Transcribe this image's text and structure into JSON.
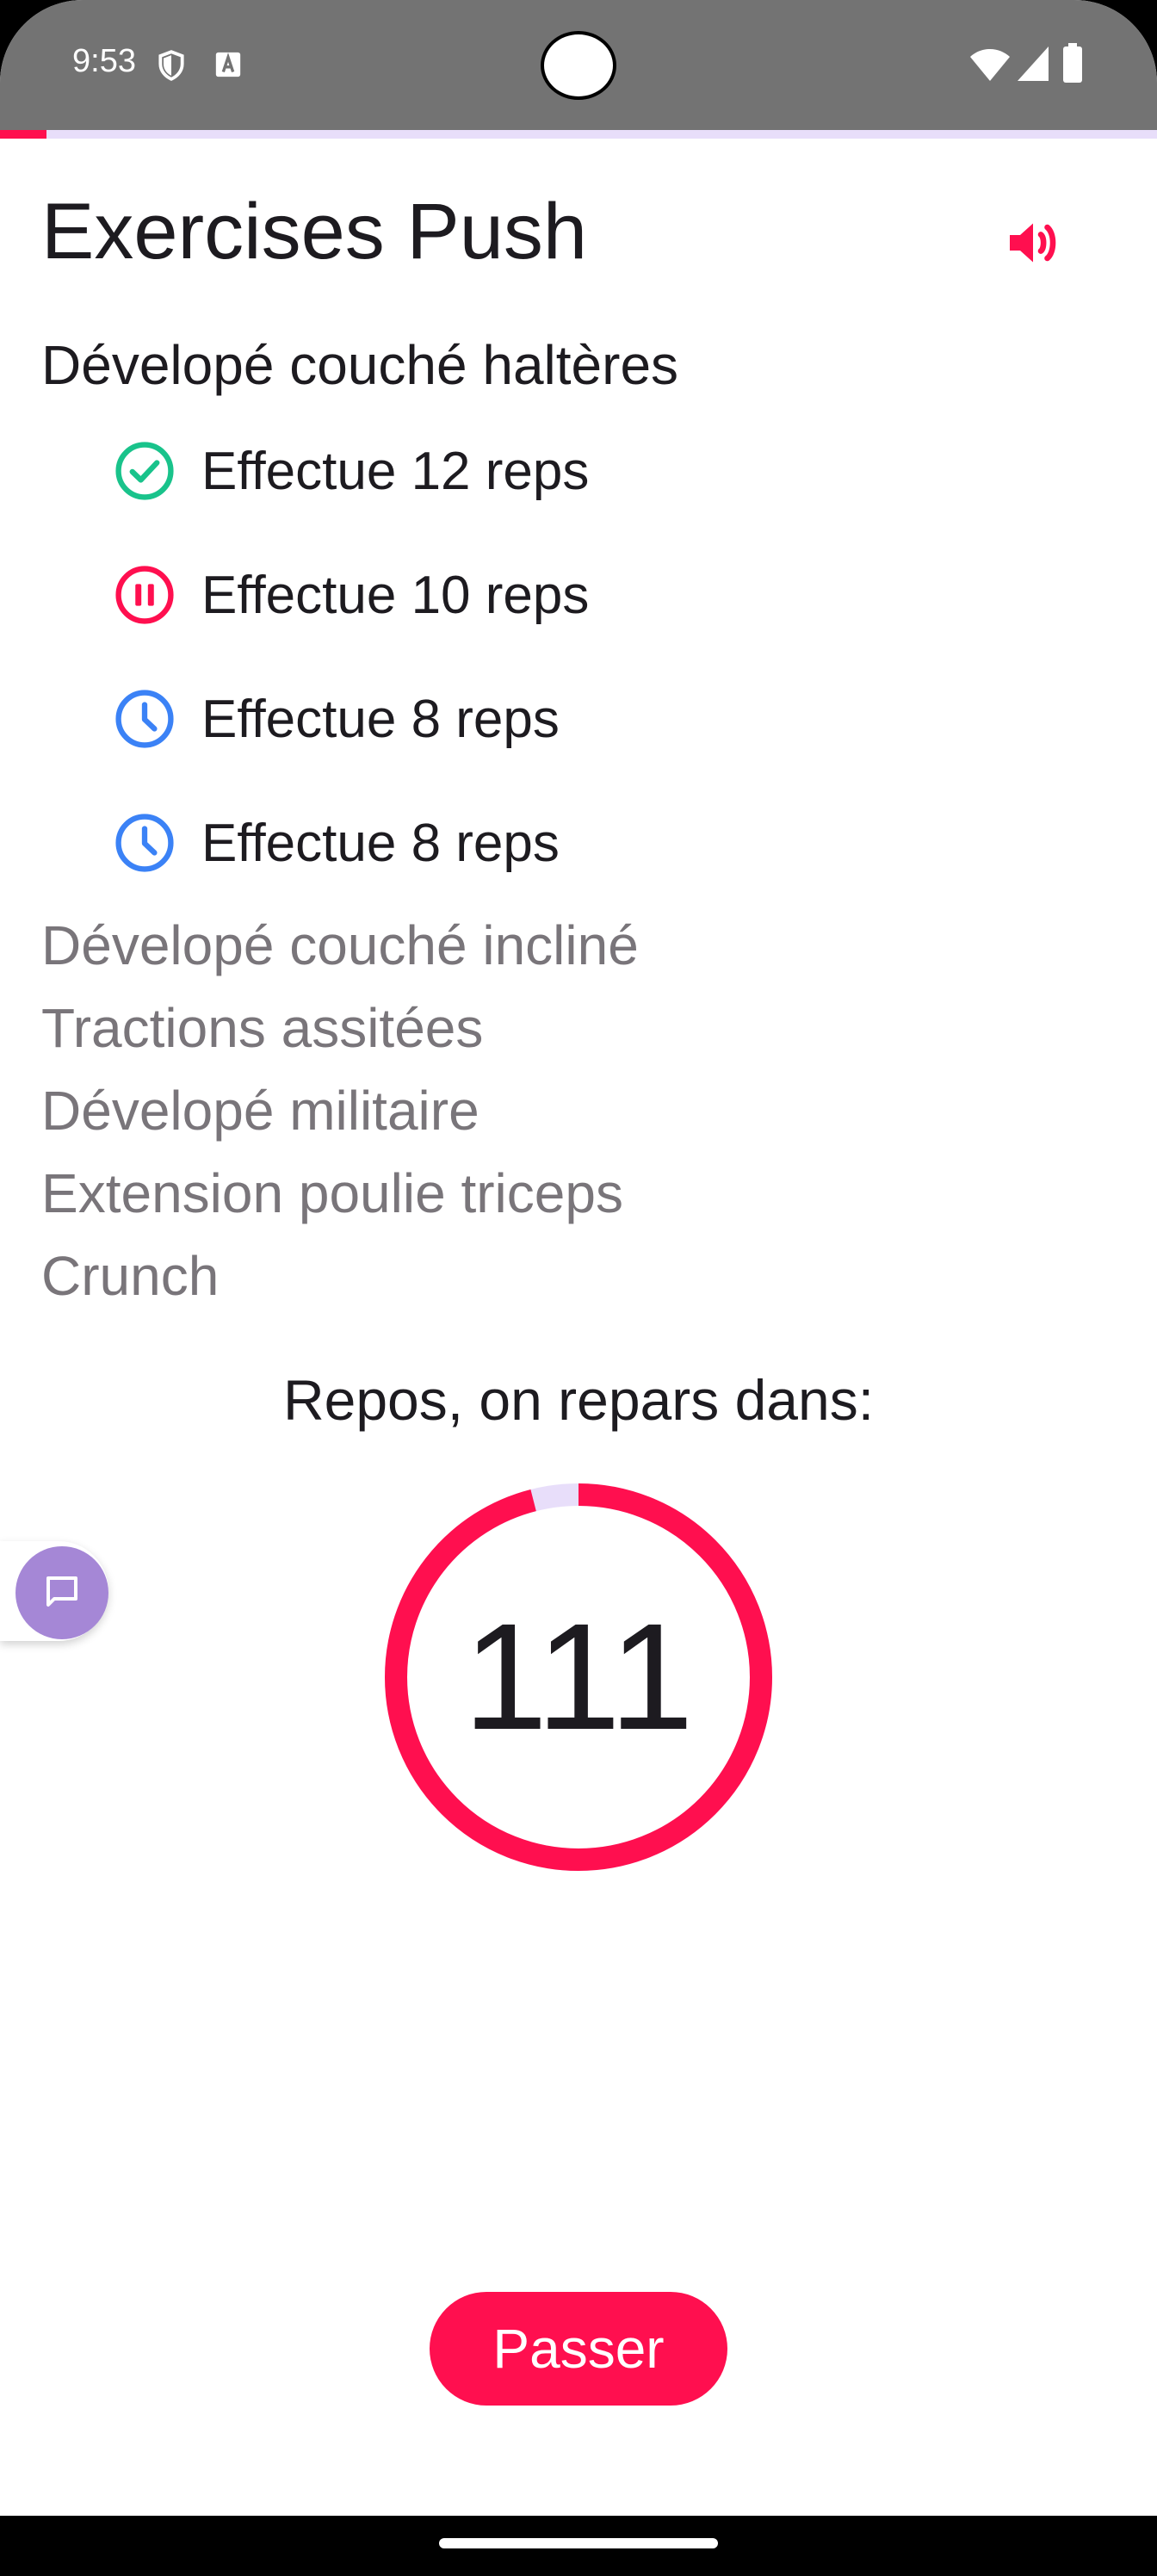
{
  "status_bar": {
    "time": "9:53",
    "icons_left": [
      "shield-icon",
      "keyboard-a-icon"
    ],
    "icons_right": [
      "wifi-icon",
      "signal-icon",
      "battery-icon"
    ],
    "background": "#737373"
  },
  "progress": {
    "fraction": 0.04,
    "fill_color": "#ff0f4f",
    "track_color": "#e8defa"
  },
  "header": {
    "title": "Exercises Push",
    "sound_icon": "volume-up-icon",
    "accent": "#ff0f4f"
  },
  "current_exercise": {
    "name": "Dévelopé couché haltères",
    "sets": [
      {
        "label": "Effectue 12 reps",
        "status": "done",
        "icon": "check-circle-icon",
        "color": "#19c38b"
      },
      {
        "label": "Effectue 10 reps",
        "status": "paused",
        "icon": "pause-circle-icon",
        "color": "#ff0f4f"
      },
      {
        "label": "Effectue 8 reps",
        "status": "pending",
        "icon": "clock-icon",
        "color": "#3b82f6"
      },
      {
        "label": "Effectue 8 reps",
        "status": "pending",
        "icon": "clock-icon",
        "color": "#3b82f6"
      }
    ]
  },
  "upcoming_exercises": [
    "Dévelopé couché incliné",
    "Tractions assitées",
    "Dévelopé militaire",
    "Extension poulie triceps",
    "Crunch"
  ],
  "rest": {
    "label": "Repos, on repars dans:",
    "seconds_remaining": "111",
    "ring_fraction": 0.96,
    "ring_color": "#ff0f4f",
    "ring_track_color": "#e8defa"
  },
  "chat": {
    "icon": "message-icon",
    "color": "#a587d6"
  },
  "actions": {
    "skip_label": "Passer"
  }
}
